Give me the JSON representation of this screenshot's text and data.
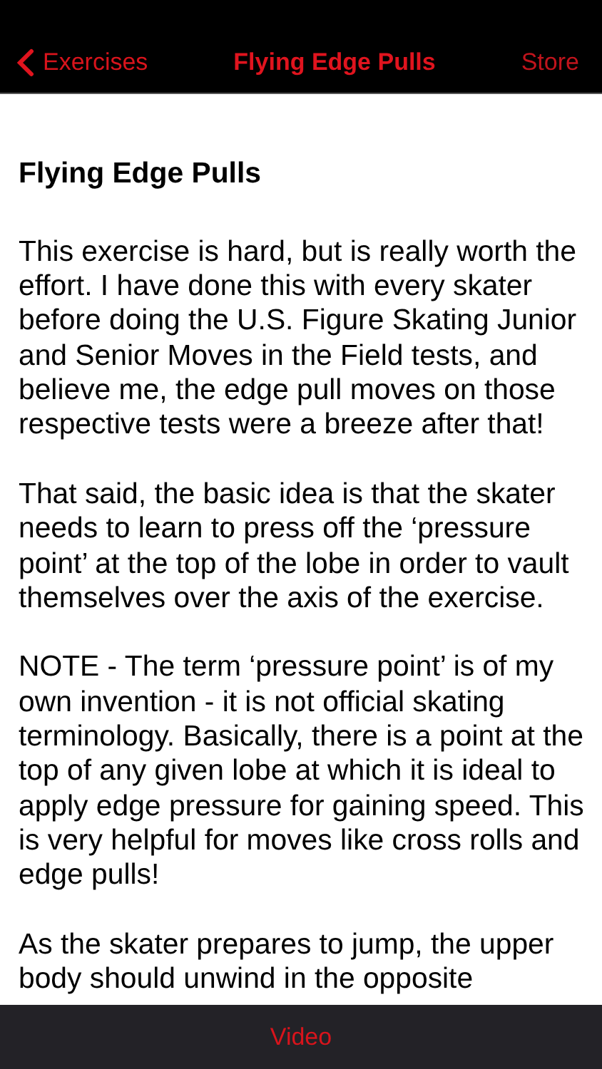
{
  "nav_bar": {
    "back_label": "Exercises",
    "title": "Flying Edge Pulls",
    "action": "Store"
  },
  "article": {
    "heading": "Flying Edge Pulls",
    "paragraphs": [
      "This exercise is hard, but is really worth the effort. I have done this with every skater before doing the U.S. Figure Skating Junior and Senior Moves in the Field tests, and believe me, the edge pull moves on those respective tests were a breeze after that!",
      "That said, the basic idea is that the skater needs to learn to press off the ‘pressure point’ at the top of the lobe in order to vault themselves over the axis of the exercise.",
      "NOTE - The term ‘pressure point’ is of my own invention - it is not official skating terminology. Basically, there is a point at the top of any given lobe at which it is ideal to apply edge pressure for gaining speed. This is very helpful for moves like cross rolls and edge pulls!",
      "As the skater prepares to jump, the upper body should unwind in the opposite"
    ]
  },
  "bottom_bar": {
    "button": "Video"
  }
}
